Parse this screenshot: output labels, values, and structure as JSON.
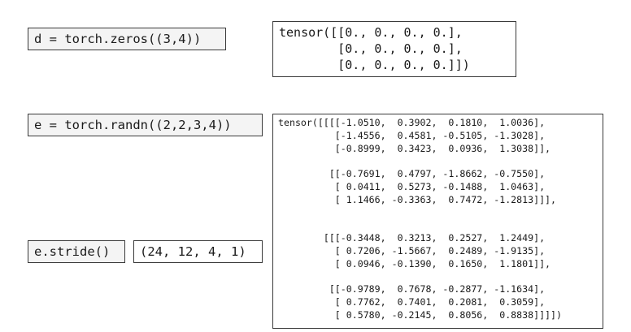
{
  "cells": {
    "zeros": {
      "code": "d = torch.zeros((3,4))",
      "output": "tensor([[0., 0., 0., 0.],\n        [0., 0., 0., 0.],\n        [0., 0., 0., 0.]])"
    },
    "randn": {
      "code": "e = torch.randn((2,2,3,4))",
      "output": "tensor([[[[-1.0510,  0.3902,  0.1810,  1.0036],\n          [-1.4556,  0.4581, -0.5105, -1.3028],\n          [-0.8999,  0.3423,  0.0936,  1.3038]],\n\n         [[-0.7691,  0.4797, -1.8662, -0.7550],\n          [ 0.0411,  0.5273, -0.1488,  1.0463],\n          [ 1.1466, -0.3363,  0.7472, -1.2813]]],\n\n\n        [[[-0.3448,  0.3213,  0.2527,  1.2449],\n          [ 0.7206, -1.5667,  0.2489, -1.9135],\n          [ 0.0946, -0.1390,  0.1650,  1.1801]],\n\n         [[-0.9789,  0.7678, -0.2877, -1.1634],\n          [ 0.7762,  0.7401,  0.2081,  0.3059],\n          [ 0.5780, -0.2145,  0.8056,  0.8838]]]])"
    },
    "stride": {
      "code": "e.stride()",
      "output": "(24, 12, 4, 1)"
    }
  }
}
